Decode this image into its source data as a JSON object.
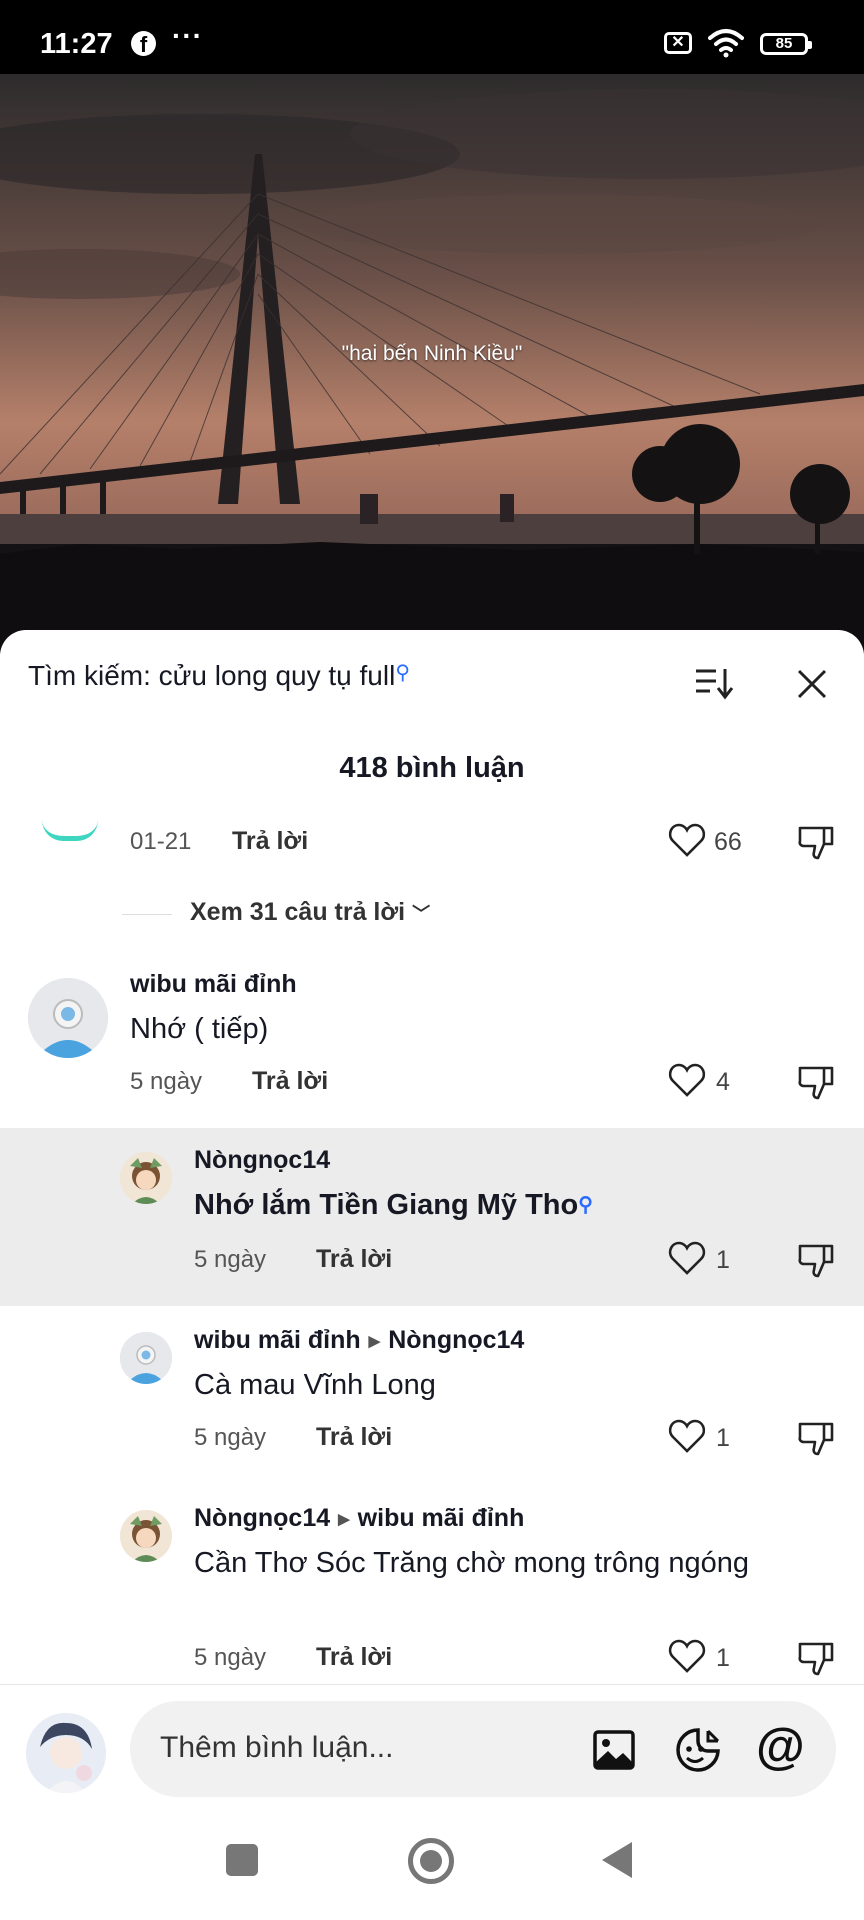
{
  "status_bar": {
    "time": "11:27",
    "fb": "f",
    "more": "···",
    "battery": "85"
  },
  "video": {
    "caption": "\"hai bến Ninh Kiều\""
  },
  "sheet": {
    "search_label": "Tìm kiếm: cửu long quy tụ full",
    "comment_count": "418 bình luận"
  },
  "comments": {
    "c0": {
      "date": "01-21",
      "reply": "Trả lời",
      "likes": "66",
      "view_replies": "Xem 31 câu trả lời"
    },
    "c1": {
      "user": "wibu mãi đỉnh",
      "text": "Nhớ ( tiếp)",
      "date": "5 ngày",
      "reply": "Trả lời",
      "likes": "4"
    },
    "r1": {
      "user": "Nòngnọc14",
      "text": "Nhớ lắm Tiền Giang Mỹ Tho",
      "date": "5 ngày",
      "reply": "Trả lời",
      "likes": "1"
    },
    "r2": {
      "user": "wibu mãi đỉnh",
      "to": "Nòngnọc14",
      "text": "Cà mau Vĩnh Long",
      "date": "5 ngày",
      "reply": "Trả lời",
      "likes": "1"
    },
    "r3": {
      "user": "Nòngnọc14",
      "to": "wibu mãi đỉnh",
      "text": "Cần Thơ Sóc Trăng chờ mong trông ngóng",
      "date": "5 ngày",
      "reply": "Trả lời",
      "likes": "1"
    }
  },
  "input": {
    "placeholder": "Thêm bình luận..."
  },
  "colors": {
    "accent_search": "#2b6bff",
    "teal": "#3ed6c0",
    "highlight": "#ececec"
  }
}
